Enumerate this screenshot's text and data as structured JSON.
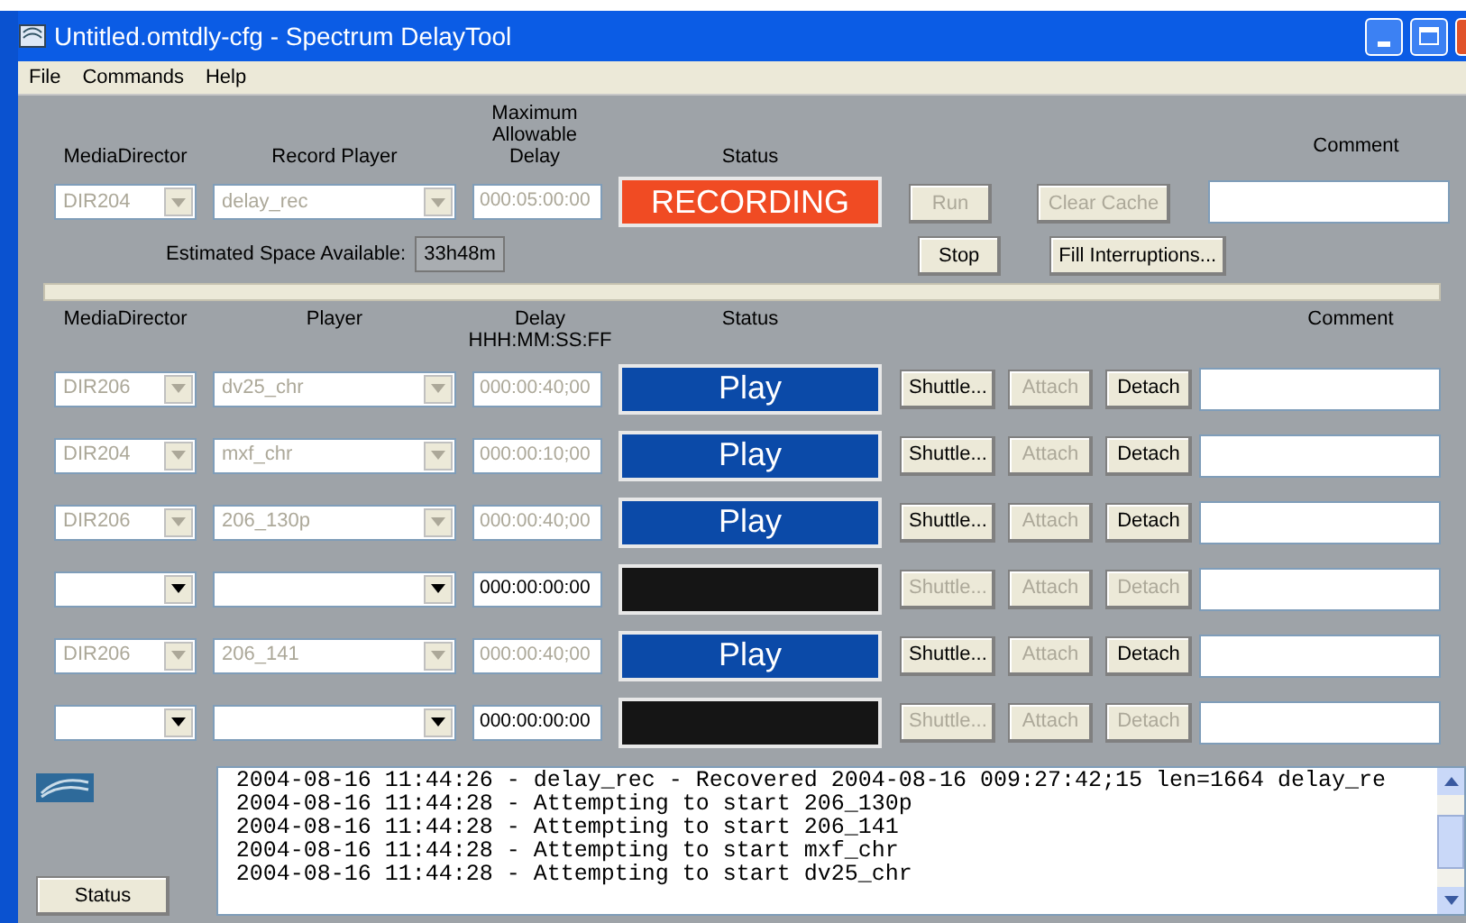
{
  "window": {
    "title": "Untitled.omtdly-cfg - Spectrum DelayTool"
  },
  "menu": [
    "File",
    "Commands",
    "Help"
  ],
  "record": {
    "headers": {
      "director": "MediaDirector",
      "player": "Record Player",
      "delay": "Maximum Allowable Delay",
      "status": "Status",
      "comment": "Comment"
    },
    "director": {
      "value": "DIR204",
      "disabled": true
    },
    "player": {
      "value": "delay_rec",
      "disabled": true
    },
    "delay": {
      "value": "000:05:00:00",
      "disabled": true
    },
    "status": {
      "kind": "recording",
      "text": "RECORDING"
    },
    "buttons": [
      {
        "label": "Run",
        "disabled": true
      },
      {
        "label": "Clear Cache",
        "disabled": true
      },
      {
        "label": "Stop",
        "disabled": false
      },
      {
        "label": "Fill Interruptions...",
        "disabled": false
      }
    ],
    "space_label": "Estimated Space Available:",
    "space_value": "33h48m"
  },
  "players": {
    "headers": {
      "director": "MediaDirector",
      "player": "Player",
      "delay": "Delay",
      "delay_format": "HHH:MM:SS:FF",
      "status": "Status",
      "comment": "Comment"
    },
    "rows": [
      {
        "director": "DIR206",
        "player": "dv25_chr",
        "delay": "000:00:40;00",
        "disabled": true,
        "status": {
          "kind": "play",
          "text": "Play"
        },
        "buttons": [
          {
            "label": "Shuttle...",
            "disabled": false
          },
          {
            "label": "Attach",
            "disabled": true
          },
          {
            "label": "Detach",
            "disabled": false
          }
        ]
      },
      {
        "director": "DIR204",
        "player": "mxf_chr",
        "delay": "000:00:10;00",
        "disabled": true,
        "status": {
          "kind": "play",
          "text": "Play"
        },
        "buttons": [
          {
            "label": "Shuttle...",
            "disabled": false
          },
          {
            "label": "Attach",
            "disabled": true
          },
          {
            "label": "Detach",
            "disabled": false
          }
        ]
      },
      {
        "director": "DIR206",
        "player": "206_130p",
        "delay": "000:00:40;00",
        "disabled": true,
        "status": {
          "kind": "play",
          "text": "Play"
        },
        "buttons": [
          {
            "label": "Shuttle...",
            "disabled": false
          },
          {
            "label": "Attach",
            "disabled": true
          },
          {
            "label": "Detach",
            "disabled": false
          }
        ]
      },
      {
        "delay": "000:00:00:00",
        "disabled": false,
        "status": {
          "kind": "idle"
        },
        "buttons": [
          {
            "label": "Shuttle...",
            "disabled": true
          },
          {
            "label": "Attach",
            "disabled": true
          },
          {
            "label": "Detach",
            "disabled": true
          }
        ]
      },
      {
        "director": "DIR206",
        "player": "206_141",
        "delay": "000:00:40;00",
        "disabled": true,
        "status": {
          "kind": "play",
          "text": "Play"
        },
        "buttons": [
          {
            "label": "Shuttle...",
            "disabled": false
          },
          {
            "label": "Attach",
            "disabled": true
          },
          {
            "label": "Detach",
            "disabled": false
          }
        ]
      },
      {
        "delay": "000:00:00:00",
        "disabled": false,
        "status": {
          "kind": "idle"
        },
        "buttons": [
          {
            "label": "Shuttle...",
            "disabled": true
          },
          {
            "label": "Attach",
            "disabled": true
          },
          {
            "label": "Detach",
            "disabled": true
          }
        ]
      }
    ]
  },
  "status_button": "Status",
  "log": [
    "2004-08-16 11:44:26 - delay_rec - Recovered 2004-08-16 009:27:42;15 len=1664 delay_re",
    "2004-08-16 11:44:28 - Attempting to start 206_130p",
    "2004-08-16 11:44:28 - Attempting to start 206_141",
    "2004-08-16 11:44:28 - Attempting to start mxf_chr",
    "2004-08-16 11:44:28 - Attempting to start dv25_chr"
  ]
}
